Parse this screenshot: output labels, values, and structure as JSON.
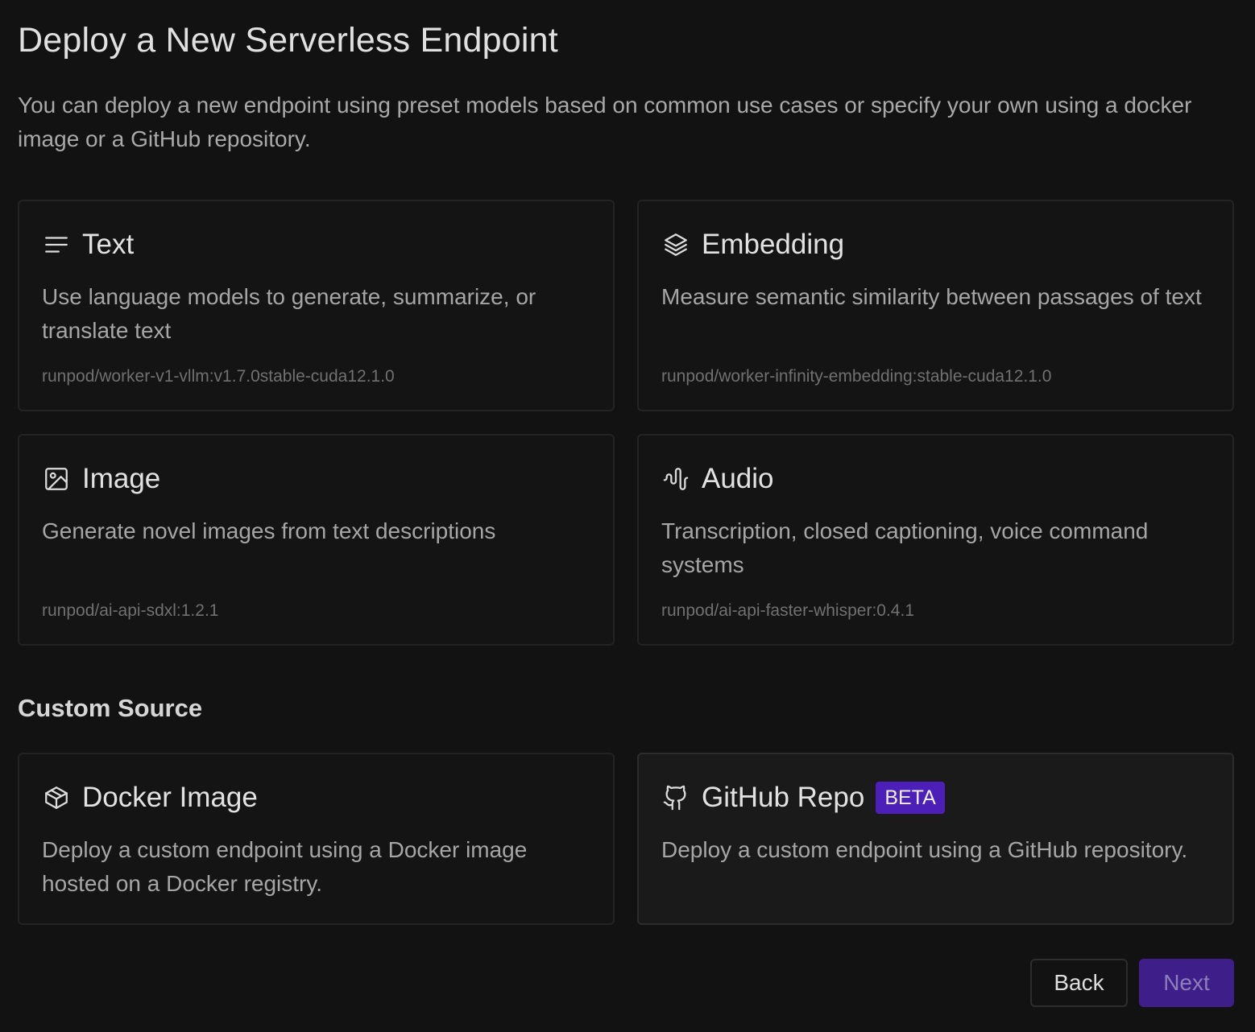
{
  "page": {
    "title": "Deploy a New Serverless Endpoint",
    "description": "You can deploy a new endpoint using preset models based on common use cases or specify your own using a docker image or a GitHub repository."
  },
  "presets": [
    {
      "icon": "text-lines-icon",
      "title": "Text",
      "description": "Use language models to generate, summarize, or translate text",
      "image": "runpod/worker-v1-vllm:v1.7.0stable-cuda12.1.0"
    },
    {
      "icon": "layers-icon",
      "title": "Embedding",
      "description": "Measure semantic similarity between passages of text",
      "image": "runpod/worker-infinity-embedding:stable-cuda12.1.0"
    },
    {
      "icon": "image-icon",
      "title": "Image",
      "description": "Generate novel images from text descriptions",
      "image": "runpod/ai-api-sdxl:1.2.1"
    },
    {
      "icon": "audio-wave-icon",
      "title": "Audio",
      "description": "Transcription, closed captioning, voice command systems",
      "image": "runpod/ai-api-faster-whisper:0.4.1"
    }
  ],
  "custom": {
    "section_title": "Custom Source",
    "items": [
      {
        "icon": "package-icon",
        "title": "Docker Image",
        "description": "Deploy a custom endpoint using a Docker image hosted on a Docker registry."
      },
      {
        "icon": "github-icon",
        "title": "GitHub Repo",
        "badge": "BETA",
        "description": "Deploy a custom endpoint using a GitHub repository."
      }
    ]
  },
  "actions": {
    "back_label": "Back",
    "next_label": "Next"
  },
  "colors": {
    "background": "#121212",
    "accent": "#4c1fb8",
    "next_button": "#3e1f8a"
  }
}
